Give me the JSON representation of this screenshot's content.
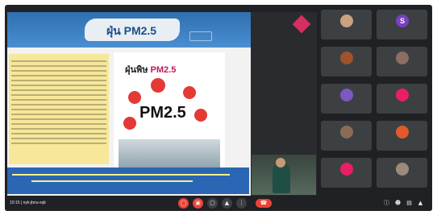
{
  "slide": {
    "title": "ฝุ่น PM2.5",
    "infographic_heading_th": "ฝุ่นพิษ",
    "infographic_heading_pm": "PM2.5",
    "infographic_big": "PM2.5"
  },
  "participants": [
    {
      "name": "",
      "avatar_color": "#c9a27e"
    },
    {
      "name": "",
      "avatar_letter": "S",
      "avatar_color": "#7b3fc4"
    },
    {
      "name": "",
      "avatar_color": "#a0522d"
    },
    {
      "name": "",
      "avatar_color": "#8d6e63"
    },
    {
      "name": "",
      "avatar_color": "#7e57c2"
    },
    {
      "name": "",
      "avatar_color": "#e91e63"
    },
    {
      "name": "",
      "avatar_color": "#8a6b56"
    },
    {
      "name": "",
      "avatar_color": "#e05a2b"
    },
    {
      "name": "",
      "avatar_color": "#e91e63"
    },
    {
      "name": "",
      "avatar_color": "#9b8b7a"
    }
  ],
  "bottom_bar": {
    "meeting_info": "10:15 | nyk-jbnu-xqk",
    "controls": [
      "mic-off",
      "camera-off",
      "captions",
      "present",
      "more"
    ],
    "colors": {
      "danger": "#ea4335",
      "surface": "#3c4043"
    }
  }
}
